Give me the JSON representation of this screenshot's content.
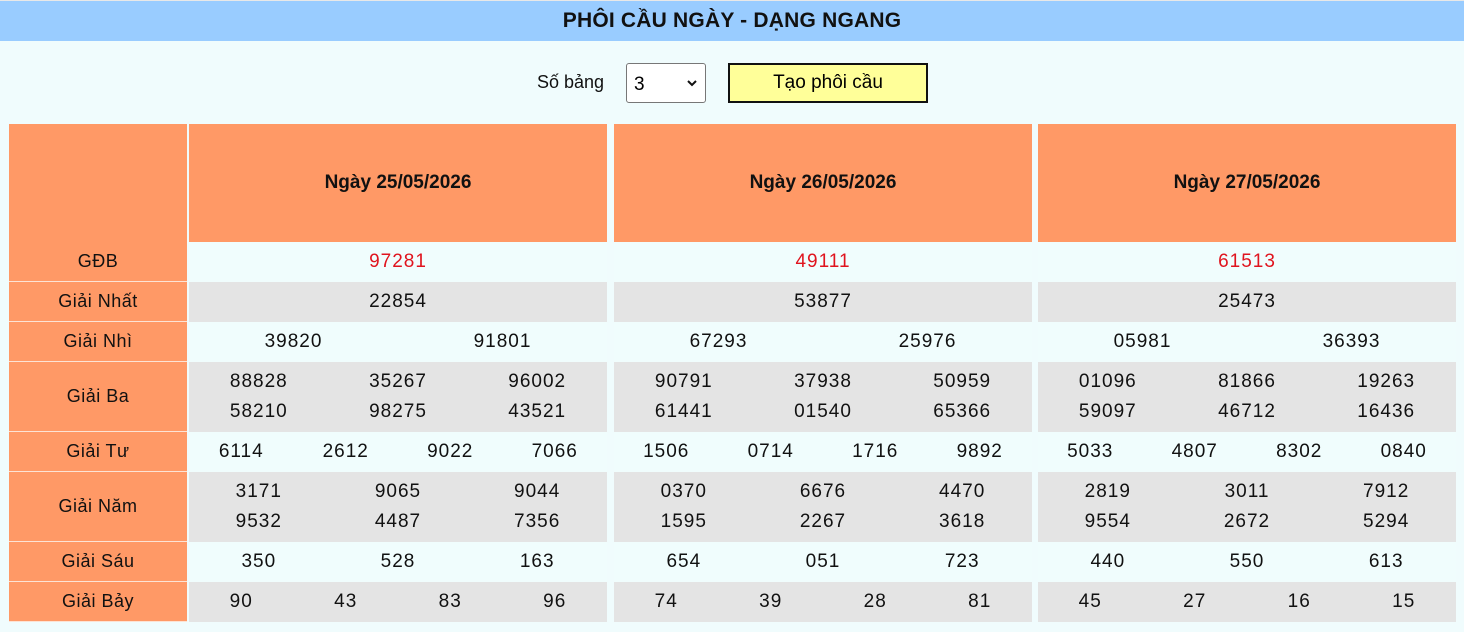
{
  "title": "PHÔI CẦU NGÀY - DẠNG NGANG",
  "controls": {
    "table_count_label": "Số bảng",
    "table_count_value": "3",
    "create_button": "Tạo phôi cầu"
  },
  "row_labels": [
    "GĐB",
    "Giải Nhất",
    "Giải Nhì",
    "Giải Ba",
    "Giải Tư",
    "Giải Năm",
    "Giải Sáu",
    "Giải Bảy"
  ],
  "tables": [
    {
      "date": "Ngày 25/05/2026",
      "gdb": "97281",
      "nhat": "22854",
      "nhi": [
        "39820",
        "91801"
      ],
      "ba": [
        [
          "88828",
          "35267",
          "96002"
        ],
        [
          "58210",
          "98275",
          "43521"
        ]
      ],
      "tu": [
        "6114",
        "2612",
        "9022",
        "7066"
      ],
      "nam": [
        [
          "3171",
          "9065",
          "9044"
        ],
        [
          "9532",
          "4487",
          "7356"
        ]
      ],
      "sau": [
        "350",
        "528",
        "163"
      ],
      "bay": [
        "90",
        "43",
        "83",
        "96"
      ]
    },
    {
      "date": "Ngày 26/05/2026",
      "gdb": "49111",
      "nhat": "53877",
      "nhi": [
        "67293",
        "25976"
      ],
      "ba": [
        [
          "90791",
          "37938",
          "50959"
        ],
        [
          "61441",
          "01540",
          "65366"
        ]
      ],
      "tu": [
        "1506",
        "0714",
        "1716",
        "9892"
      ],
      "nam": [
        [
          "0370",
          "6676",
          "4470"
        ],
        [
          "1595",
          "2267",
          "3618"
        ]
      ],
      "sau": [
        "654",
        "051",
        "723"
      ],
      "bay": [
        "74",
        "39",
        "28",
        "81"
      ]
    },
    {
      "date": "Ngày 27/05/2026",
      "gdb": "61513",
      "nhat": "25473",
      "nhi": [
        "05981",
        "36393"
      ],
      "ba": [
        [
          "01096",
          "81866",
          "19263"
        ],
        [
          "59097",
          "46712",
          "16436"
        ]
      ],
      "tu": [
        "5033",
        "4807",
        "8302",
        "0840"
      ],
      "nam": [
        [
          "2819",
          "3011",
          "7912"
        ],
        [
          "9554",
          "2672",
          "5294"
        ]
      ],
      "sau": [
        "440",
        "550",
        "613"
      ],
      "bay": [
        "45",
        "27",
        "16",
        "15"
      ]
    }
  ]
}
